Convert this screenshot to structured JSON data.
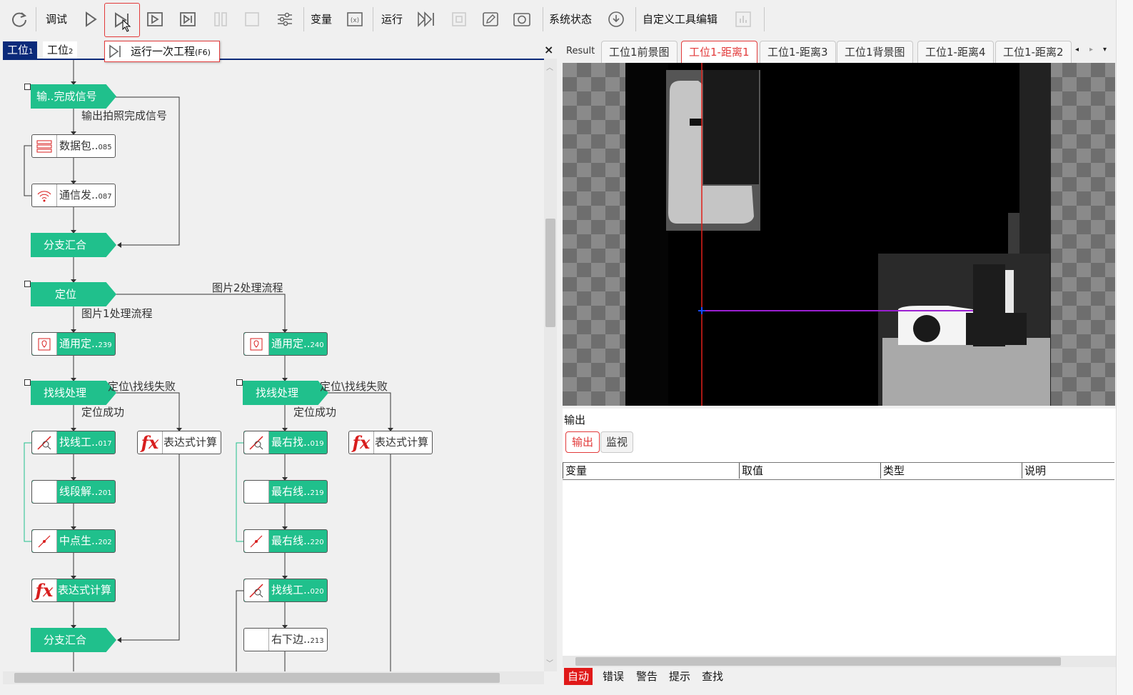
{
  "toolbar": {
    "debug_label": "调试",
    "variables_label": "变量",
    "run_label": "运行",
    "system_status_label": "系统状态",
    "custom_tool_edit_label": "自定义工具编辑"
  },
  "tooltip": {
    "text": "运行一次工程",
    "shortcut": "(F6)"
  },
  "flow_tabs": [
    {
      "label": "工位",
      "suffix": "1"
    },
    {
      "label": "工位",
      "suffix": "2"
    }
  ],
  "flow": {
    "output_signal": "输..完成信号",
    "output_photo_signal": "输出拍照完成信号",
    "data_packet": "数据包..",
    "data_packet_id": "085",
    "comm_send": "通信发..",
    "comm_send_id": "087",
    "branch_merge_1": "分支汇合",
    "locate": "定位",
    "pic2_flow": "图片2处理流程",
    "pic1_flow": "图片1处理流程",
    "general_locate_a": "通用定..",
    "general_locate_a_id": "239",
    "general_locate_b": "通用定..",
    "general_locate_b_id": "240",
    "find_line_a": "找线处理",
    "find_line_b": "找线处理",
    "locate_fail_a": "定位\\找线失败",
    "locate_fail_b": "定位\\找线失败",
    "locate_ok_a": "定位成功",
    "locate_ok_b": "定位成功",
    "find_line_tool_a": "找线工..",
    "find_line_tool_a_id": "017",
    "expr_a": "表达式计算",
    "rightmost_find": "最右找..",
    "rightmost_find_id": "019",
    "expr_b": "表达式计算",
    "segment": "线段解..",
    "segment_id": "201",
    "rightmost_line_a": "最右线..",
    "rightmost_line_a_id": "219",
    "midpoint": "中点生..",
    "midpoint_id": "202",
    "rightmost_line_b": "最右线..",
    "rightmost_line_b_id": "220",
    "expr_c": "表达式计算",
    "find_line_tool_b": "找线工..",
    "find_line_tool_b_id": "020",
    "branch_merge_2": "分支汇合",
    "bottom_right": "右下边..",
    "bottom_right_id": "213"
  },
  "result_tabs": [
    {
      "label": "Result"
    },
    {
      "label": "工位1前景图"
    },
    {
      "label": "工位1-距离1"
    },
    {
      "label": "工位1-距离3"
    },
    {
      "label": "工位1背景图"
    },
    {
      "label": "工位1-距离4"
    },
    {
      "label": "工位1-距离2"
    }
  ],
  "output": {
    "title": "输出",
    "tab_output": "输出",
    "tab_monitor": "监视",
    "columns": [
      "变量",
      "取值",
      "类型",
      "说明"
    ]
  },
  "status_tabs": [
    "自动",
    "错误",
    "警告",
    "提示",
    "查找"
  ],
  "colors": {
    "accent": "#20c08c",
    "active_red": "#e23a3a",
    "dark_blue": "#0b2a7a"
  }
}
